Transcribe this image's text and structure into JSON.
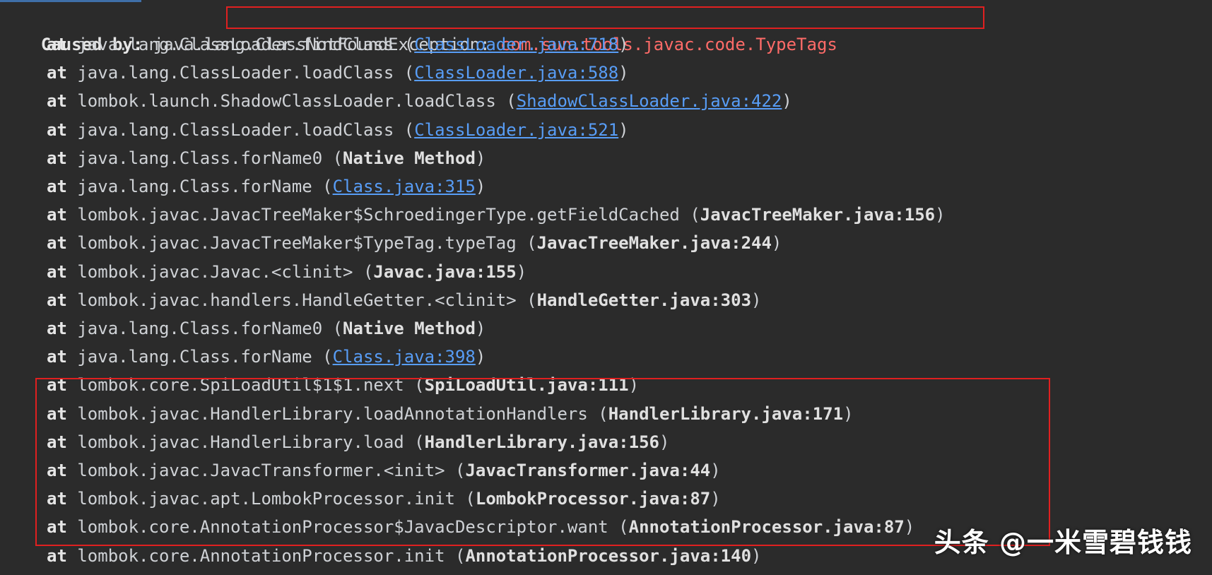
{
  "caused_by": {
    "prefix": "Caused by:",
    "package": " java.lang",
    "exception_class": ".ClassNotFoundException:",
    "exception_message": " com.sun.tools.javac.code.TypeTags"
  },
  "frames": [
    {
      "at": "at",
      "method": "java.lang.ClassLoader.findClass (",
      "source": "ClassLoader.java:718",
      "link": true,
      "close": ")"
    },
    {
      "at": "at",
      "method": "java.lang.ClassLoader.loadClass (",
      "source": "ClassLoader.java:588",
      "link": true,
      "close": ")"
    },
    {
      "at": "at",
      "method": "lombok.launch.ShadowClassLoader.loadClass (",
      "source": "ShadowClassLoader.java:422",
      "link": true,
      "close": ")"
    },
    {
      "at": "at",
      "method": "java.lang.ClassLoader.loadClass (",
      "source": "ClassLoader.java:521",
      "link": true,
      "close": ")"
    },
    {
      "at": "at",
      "method": "java.lang.Class.forName0 (",
      "source": "Native Method",
      "link": false,
      "close": ")"
    },
    {
      "at": "at",
      "method": "java.lang.Class.forName (",
      "source": "Class.java:315",
      "link": true,
      "close": ")"
    },
    {
      "at": "at",
      "method": "lombok.javac.JavacTreeMaker$SchroedingerType.getFieldCached (",
      "source": "JavacTreeMaker.java:156",
      "link": false,
      "close": ")"
    },
    {
      "at": "at",
      "method": "lombok.javac.JavacTreeMaker$TypeTag.typeTag (",
      "source": "JavacTreeMaker.java:244",
      "link": false,
      "close": ")"
    },
    {
      "at": "at",
      "method": "lombok.javac.Javac.<clinit> (",
      "source": "Javac.java:155",
      "link": false,
      "close": ")"
    },
    {
      "at": "at",
      "method": "lombok.javac.handlers.HandleGetter.<clinit> (",
      "source": "HandleGetter.java:303",
      "link": false,
      "close": ")"
    },
    {
      "at": "at",
      "method": "java.lang.Class.forName0 (",
      "source": "Native Method",
      "link": false,
      "close": ")"
    },
    {
      "at": "at",
      "method": "java.lang.Class.forName (",
      "source": "Class.java:398",
      "link": true,
      "close": ")"
    },
    {
      "at": "at",
      "method": "lombok.core.SpiLoadUtil$1$1.next (",
      "source": "SpiLoadUtil.java:111",
      "link": false,
      "close": ")"
    },
    {
      "at": "at",
      "method": "lombok.javac.HandlerLibrary.loadAnnotationHandlers (",
      "source": "HandlerLibrary.java:171",
      "link": false,
      "close": ")"
    },
    {
      "at": "at",
      "method": "lombok.javac.HandlerLibrary.load (",
      "source": "HandlerLibrary.java:156",
      "link": false,
      "close": ")"
    },
    {
      "at": "at",
      "method": "lombok.javac.JavacTransformer.<init> (",
      "source": "JavacTransformer.java:44",
      "link": false,
      "close": ")"
    },
    {
      "at": "at",
      "method": "lombok.javac.apt.LombokProcessor.init (",
      "source": "LombokProcessor.java:87",
      "link": false,
      "close": ")"
    },
    {
      "at": "at",
      "method": "lombok.core.AnnotationProcessor$JavacDescriptor.want (",
      "source": "AnnotationProcessor.java:87",
      "link": false,
      "close": ")"
    },
    {
      "at": "at",
      "method": "lombok.core.AnnotationProcessor.init (",
      "source": "AnnotationProcessor.java:140",
      "link": false,
      "close": ")"
    }
  ],
  "watermark": "头条 @一米雪碧钱钱",
  "colors": {
    "background": "#2b2b2b",
    "link": "#589df6",
    "highlight_box": "#e02020",
    "exception_text": "#ff6b68"
  }
}
